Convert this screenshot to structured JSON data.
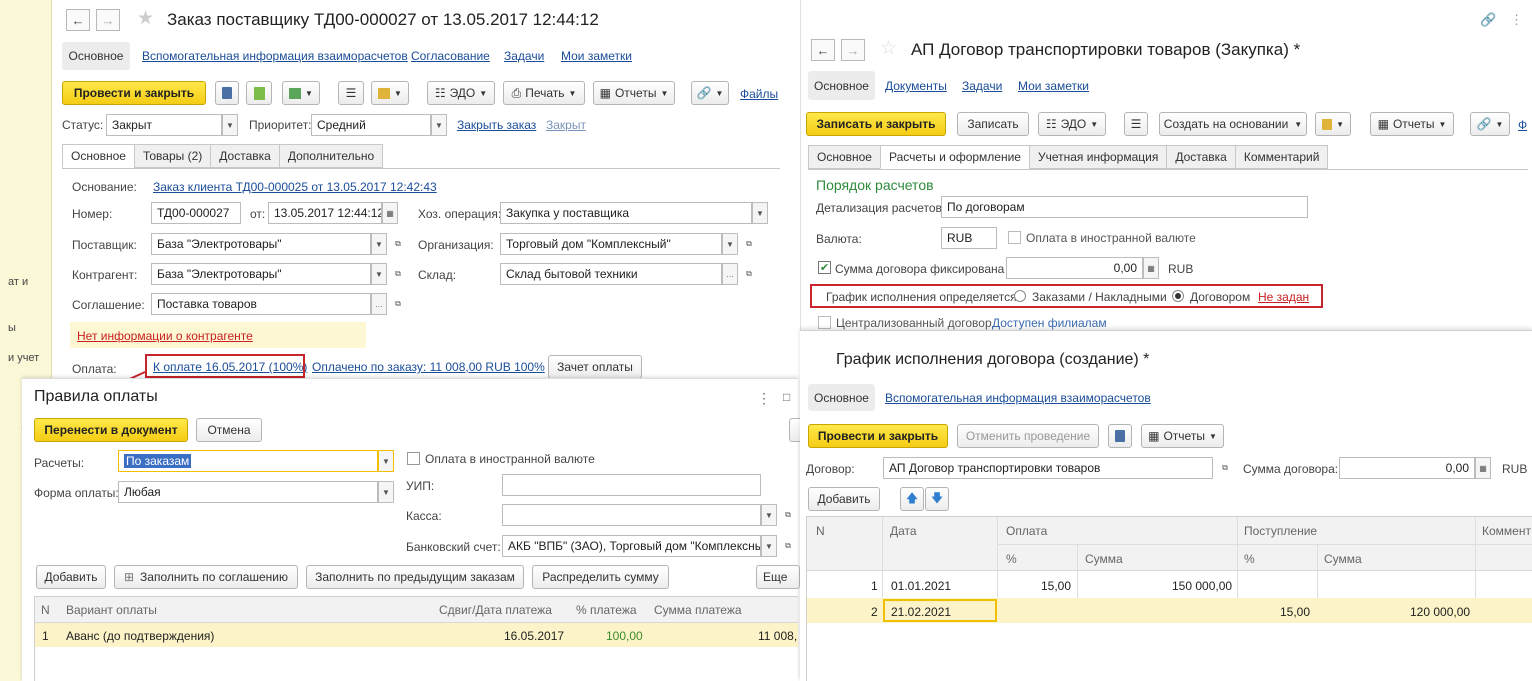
{
  "left_strip": {
    "items": [
      "ат и",
      "ы",
      "и учет"
    ]
  },
  "order": {
    "title": "Заказ поставщику ТД00-000027 от 13.05.2017 12:44:12",
    "nav_tabs": [
      "Основное",
      "Вспомогательная информация взаиморасчетов",
      "Согласование",
      "Задачи",
      "Мои заметки"
    ],
    "toolbar": {
      "post_close": "Провести и закрыть",
      "edo": "ЭДО",
      "print": "Печать",
      "reports": "Отчеты",
      "files": "Файлы"
    },
    "status_label": "Статус:",
    "status_value": "Закрыт",
    "priority_label": "Приоритет:",
    "priority_value": "Средний",
    "close_order": "Закрыть заказ",
    "closed": "Закрыт",
    "tabs": [
      "Основное",
      "Товары (2)",
      "Доставка",
      "Дополнительно"
    ],
    "basis_label": "Основание:",
    "basis_value": "Заказ клиента ТД00-000025 от 13.05.2017 12:42:43",
    "number_label": "Номер:",
    "number_value": "ТД00-000027",
    "from_label": "от:",
    "date_value": "13.05.2017 12:44:12",
    "operation_label": "Хоз. операция:",
    "operation_value": "Закупка у поставщика",
    "supplier_label": "Поставщик:",
    "supplier_value": "База \"Электротовары\"",
    "org_label": "Организация:",
    "org_value": "Торговый дом \"Комплексный\"",
    "counterparty_label": "Контрагент:",
    "counterparty_value": "База \"Электротовары\"",
    "warehouse_label": "Склад:",
    "warehouse_value": "Склад бытовой техники",
    "agreement_label": "Соглашение:",
    "agreement_value": "Поставка товаров",
    "no_info": "Нет информации о контрагенте",
    "payment_label": "Оплата:",
    "payment_link": "К оплате 16.05.2017 (100%)",
    "paid_link": "Оплачено по заказу: 11 008,00 RUB 100%",
    "offset_btn": "Зачет оплаты"
  },
  "payment_rules": {
    "title": "Правила оплаты",
    "transfer_btn": "Перенести в документ",
    "cancel_btn": "Отмена",
    "settlements_label": "Расчеты:",
    "settlements_value": "По заказам",
    "foreign_currency": "Оплата в иностранной валюте",
    "form_label": "Форма оплаты:",
    "form_value": "Любая",
    "uip_label": "УИП:",
    "cash_label": "Касса:",
    "bank_label": "Банковский счет:",
    "bank_value": "АКБ \"ВПБ\" (ЗАО), Торговый дом \"Комплексный\"",
    "add_btn": "Добавить",
    "fill_agreement_btn": "Заполнить по соглашению",
    "fill_prev_btn": "Заполнить по предыдущим заказам",
    "distribute_btn": "Распределить сумму",
    "more_btn": "Еще",
    "columns": [
      "N",
      "Вариант оплаты",
      "Сдвиг/Дата платежа",
      "% платежа",
      "Сумма платежа"
    ],
    "rows": [
      {
        "n": "1",
        "variant": "Аванс (до подтверждения)",
        "date": "16.05.2017",
        "pct": "100,00",
        "sum": "11 008,"
      }
    ]
  },
  "contract": {
    "title": "АП Договор транспортировки товаров (Закупка) *",
    "nav_tabs": [
      "Основное",
      "Документы",
      "Задачи",
      "Мои заметки"
    ],
    "toolbar": {
      "write_close": "Записать и закрыть",
      "write": "Записать",
      "edo": "ЭДО",
      "create_basis": "Создать на основании",
      "reports": "Отчеты"
    },
    "tabs": [
      "Основное",
      "Расчеты и оформление",
      "Учетная информация",
      "Доставка",
      "Комментарий"
    ],
    "section_title": "Порядок расчетов",
    "detail_label": "Детализация расчетов:",
    "detail_value": "По договорам",
    "currency_label": "Валюта:",
    "currency_value": "RUB",
    "foreign_currency": "Оплата в иностранной валюте",
    "fixed_sum_label": "Сумма договора фиксирована",
    "fixed_sum_value": "0,00",
    "fixed_sum_cur": "RUB",
    "schedule_label": "График исполнения определяется:",
    "opt_orders": "Заказами / Накладными",
    "opt_contract": "Договором",
    "not_set": "Не задан",
    "centralized": "Централизованный договор",
    "branches": "Доступен филиалам"
  },
  "schedule": {
    "title": "График исполнения договора (создание) *",
    "nav_tabs": [
      "Основное",
      "Вспомогательная информация взаиморасчетов"
    ],
    "toolbar": {
      "post_close": "Провести и закрыть",
      "cancel_post": "Отменить проведение",
      "reports": "Отчеты"
    },
    "contract_label": "Договор:",
    "contract_value": "АП Договор транспортировки товаров",
    "sum_label": "Сумма договора:",
    "sum_value": "0,00",
    "sum_cur": "RUB",
    "add_btn": "Добавить",
    "col_n": "N",
    "col_date": "Дата",
    "col_payment": "Оплата",
    "col_receipt": "Поступление",
    "col_comment": "Коммент",
    "sub_pct": "%",
    "sub_sum": "Сумма",
    "rows": [
      {
        "n": "1",
        "date": "01.01.2021",
        "pay_pct": "15,00",
        "pay_sum": "150 000,00",
        "rec_pct": "",
        "rec_sum": ""
      },
      {
        "n": "2",
        "date": "21.02.2021",
        "pay_pct": "",
        "pay_sum": "",
        "rec_pct": "15,00",
        "rec_sum": "120 000,00"
      }
    ]
  }
}
